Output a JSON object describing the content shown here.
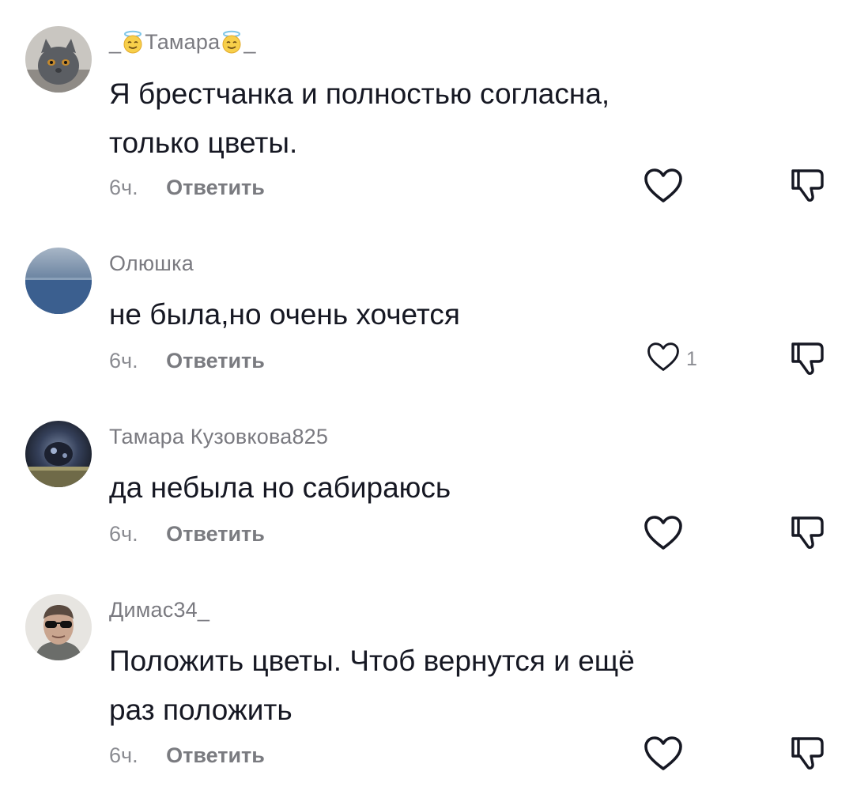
{
  "comments": [
    {
      "username_prefix": "_",
      "username_main": "Тамара",
      "username_suffix": "_",
      "username_emoji": "halo-smile-emoji",
      "lines": [
        "Я брестчанка и полностью согласна,",
        "только цветы."
      ],
      "time": "6ч.",
      "reply": "Ответить",
      "likes": "",
      "avatar": "cat-avatar"
    },
    {
      "username": "Олюшка",
      "lines": [
        "не была,но очень хочется"
      ],
      "time": "6ч.",
      "reply": "Ответить",
      "likes": "1",
      "avatar": "landscape-avatar"
    },
    {
      "username": "Тамара Кузовкова825",
      "lines": [
        "да небыла но сабираюсь"
      ],
      "time": "6ч.",
      "reply": "Ответить",
      "likes": "",
      "avatar": "dark-photo-avatar"
    },
    {
      "username": "Димас34_",
      "lines": [
        "Положить цветы. Чтоб вернутся и ещё",
        "раз положить"
      ],
      "time": "6ч.",
      "reply": "Ответить",
      "likes": "",
      "avatar": "man-sunglasses-avatar"
    }
  ],
  "icons": {
    "like": "heart-outline-icon",
    "dislike": "thumbs-down-outline-icon"
  },
  "colors": {
    "text": "#161823",
    "secondary": "#8a8b91",
    "background": "#ffffff"
  }
}
